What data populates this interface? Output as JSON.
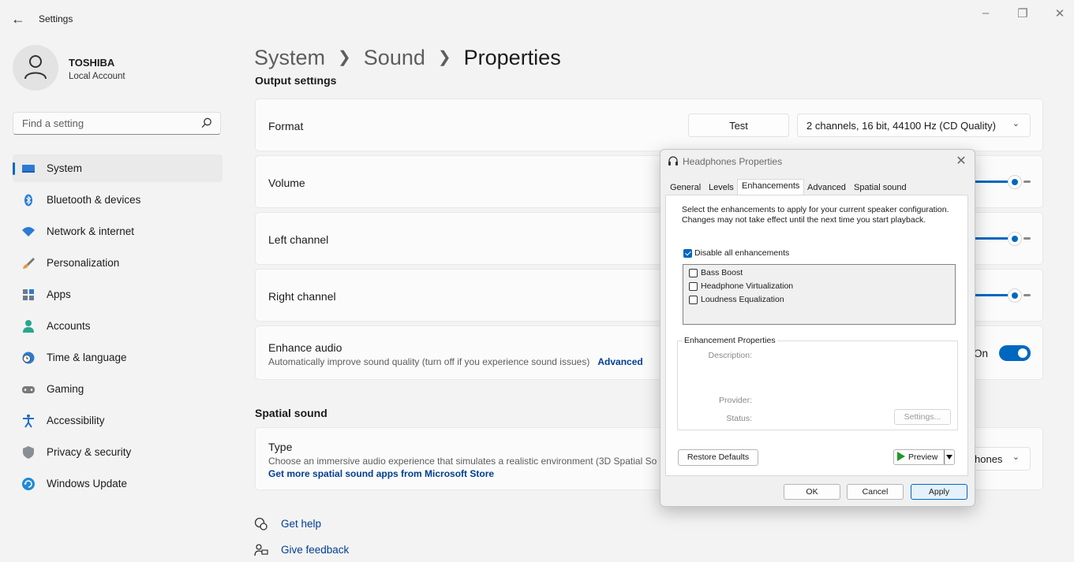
{
  "window": {
    "title": "Settings"
  },
  "account": {
    "name": "TOSHIBA",
    "type": "Local Account"
  },
  "search": {
    "placeholder": "Find a setting"
  },
  "nav": [
    {
      "label": "System",
      "icon": "monitor-icon",
      "selected": true
    },
    {
      "label": "Bluetooth & devices",
      "icon": "bluetooth-icon"
    },
    {
      "label": "Network & internet",
      "icon": "wifi-icon"
    },
    {
      "label": "Personalization",
      "icon": "brush-icon"
    },
    {
      "label": "Apps",
      "icon": "apps-icon"
    },
    {
      "label": "Accounts",
      "icon": "person-icon"
    },
    {
      "label": "Time & language",
      "icon": "globe-clock-icon"
    },
    {
      "label": "Gaming",
      "icon": "gamepad-icon"
    },
    {
      "label": "Accessibility",
      "icon": "accessibility-icon"
    },
    {
      "label": "Privacy & security",
      "icon": "shield-icon"
    },
    {
      "label": "Windows Update",
      "icon": "update-icon"
    }
  ],
  "breadcrumb": {
    "level1": "System",
    "level2": "Sound",
    "current": "Properties"
  },
  "output": {
    "section_label": "Output settings",
    "format_label": "Format",
    "test_button": "Test",
    "format_value": "2 channels, 16 bit, 44100 Hz (CD Quality)",
    "volume_label": "Volume",
    "volume_value": 100,
    "left_label": "Left channel",
    "left_value": 100,
    "right_label": "Right channel",
    "right_value": 100,
    "enhance_label": "Enhance audio",
    "enhance_desc": "Automatically improve sound quality (turn off if you experience sound issues)",
    "enhance_link": "Advanced",
    "enhance_state": "On"
  },
  "spatial": {
    "section_label": "Spatial sound",
    "type_label": "Type",
    "type_desc": "Choose an immersive audio experience that simulates a realistic environment (3D Spatial So",
    "store_link": "Get more spatial sound apps from Microsoft Store",
    "select_value": "hones"
  },
  "help": {
    "get_help": "Get help",
    "give_feedback": "Give feedback"
  },
  "dialog": {
    "title": "Headphones Properties",
    "tabs": [
      "General",
      "Levels",
      "Enhancements",
      "Advanced",
      "Spatial sound"
    ],
    "active_tab": "Enhancements",
    "instructions": "Select the enhancements to apply for your current speaker configuration. Changes may not take effect until the next time you start playback.",
    "disable_all_label": "Disable all enhancements",
    "disable_all_checked": true,
    "enhancements": [
      {
        "label": "Bass Boost",
        "checked": false
      },
      {
        "label": "Headphone Virtualization",
        "checked": false
      },
      {
        "label": "Loudness Equalization",
        "checked": false
      }
    ],
    "properties_group": "Enhancement Properties",
    "description_label": "Description:",
    "provider_label": "Provider:",
    "status_label": "Status:",
    "settings_button": "Settings...",
    "restore_button": "Restore Defaults",
    "preview_button": "Preview",
    "ok_button": "OK",
    "cancel_button": "Cancel",
    "apply_button": "Apply"
  }
}
